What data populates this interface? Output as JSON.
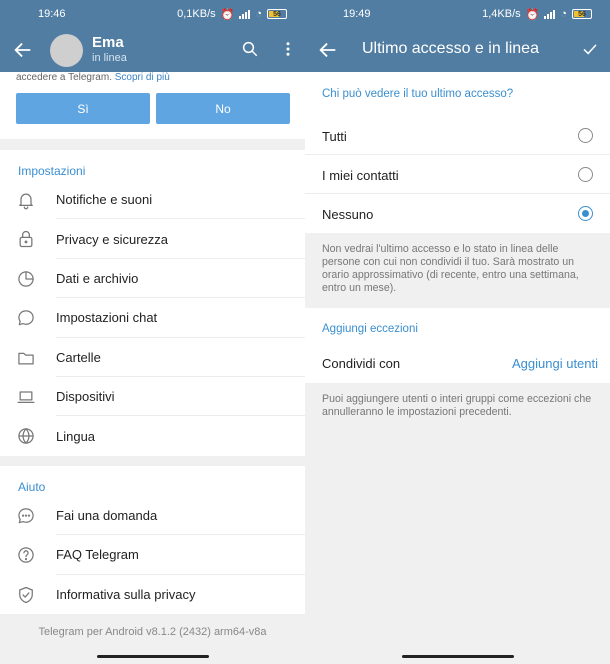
{
  "left": {
    "status_bar": {
      "time": "19:46",
      "net": "0,1KB/s",
      "battery": "56"
    },
    "header": {
      "name": "Ema",
      "status": "in linea"
    },
    "prompt": {
      "text": "accedere a Telegram.",
      "link": "Scopri di più"
    },
    "buttons": {
      "yes": "Sì",
      "no": "No"
    },
    "settings": {
      "title": "Impostazioni",
      "items": [
        {
          "label": "Notifiche e suoni",
          "icon": "bell-icon"
        },
        {
          "label": "Privacy e sicurezza",
          "icon": "lock-icon"
        },
        {
          "label": "Dati e archivio",
          "icon": "pie-chart-icon"
        },
        {
          "label": "Impostazioni chat",
          "icon": "chat-bubble-icon"
        },
        {
          "label": "Cartelle",
          "icon": "folder-icon"
        },
        {
          "label": "Dispositivi",
          "icon": "laptop-icon"
        },
        {
          "label": "Lingua",
          "icon": "globe-icon"
        }
      ]
    },
    "help": {
      "title": "Aiuto",
      "items": [
        {
          "label": "Fai una domanda",
          "icon": "chat-dots-icon"
        },
        {
          "label": "FAQ Telegram",
          "icon": "question-circle-icon"
        },
        {
          "label": "Informativa sulla privacy",
          "icon": "shield-check-icon"
        }
      ]
    },
    "version": "Telegram per Android v8.1.2 (2432) arm64-v8a"
  },
  "right": {
    "status_bar": {
      "time": "19:49",
      "net": "1,4KB/s",
      "battery": "56"
    },
    "header": {
      "title": "Ultimo accesso e in linea"
    },
    "who": {
      "title": "Chi può vedere il tuo ultimo accesso?",
      "options": [
        {
          "label": "Tutti",
          "selected": false
        },
        {
          "label": "I miei contatti",
          "selected": false
        },
        {
          "label": "Nessuno",
          "selected": true
        }
      ],
      "note": "Non vedrai l'ultimo accesso e lo stato in linea delle persone con cui non condividi il tuo. Sarà mostrato un orario approssimativo (di recente, entro una settimana, entro un mese)."
    },
    "exceptions": {
      "title": "Aggiungi eccezioni",
      "row_label": "Condividi con",
      "row_action": "Aggiungi utenti",
      "note": "Puoi aggiungere utenti o interi gruppi come eccezioni che annulleranno le impostazioni precedenti."
    }
  },
  "colors": {
    "primary": "#517da2",
    "accent": "#3a8fd0",
    "button": "#5fa5e2"
  }
}
